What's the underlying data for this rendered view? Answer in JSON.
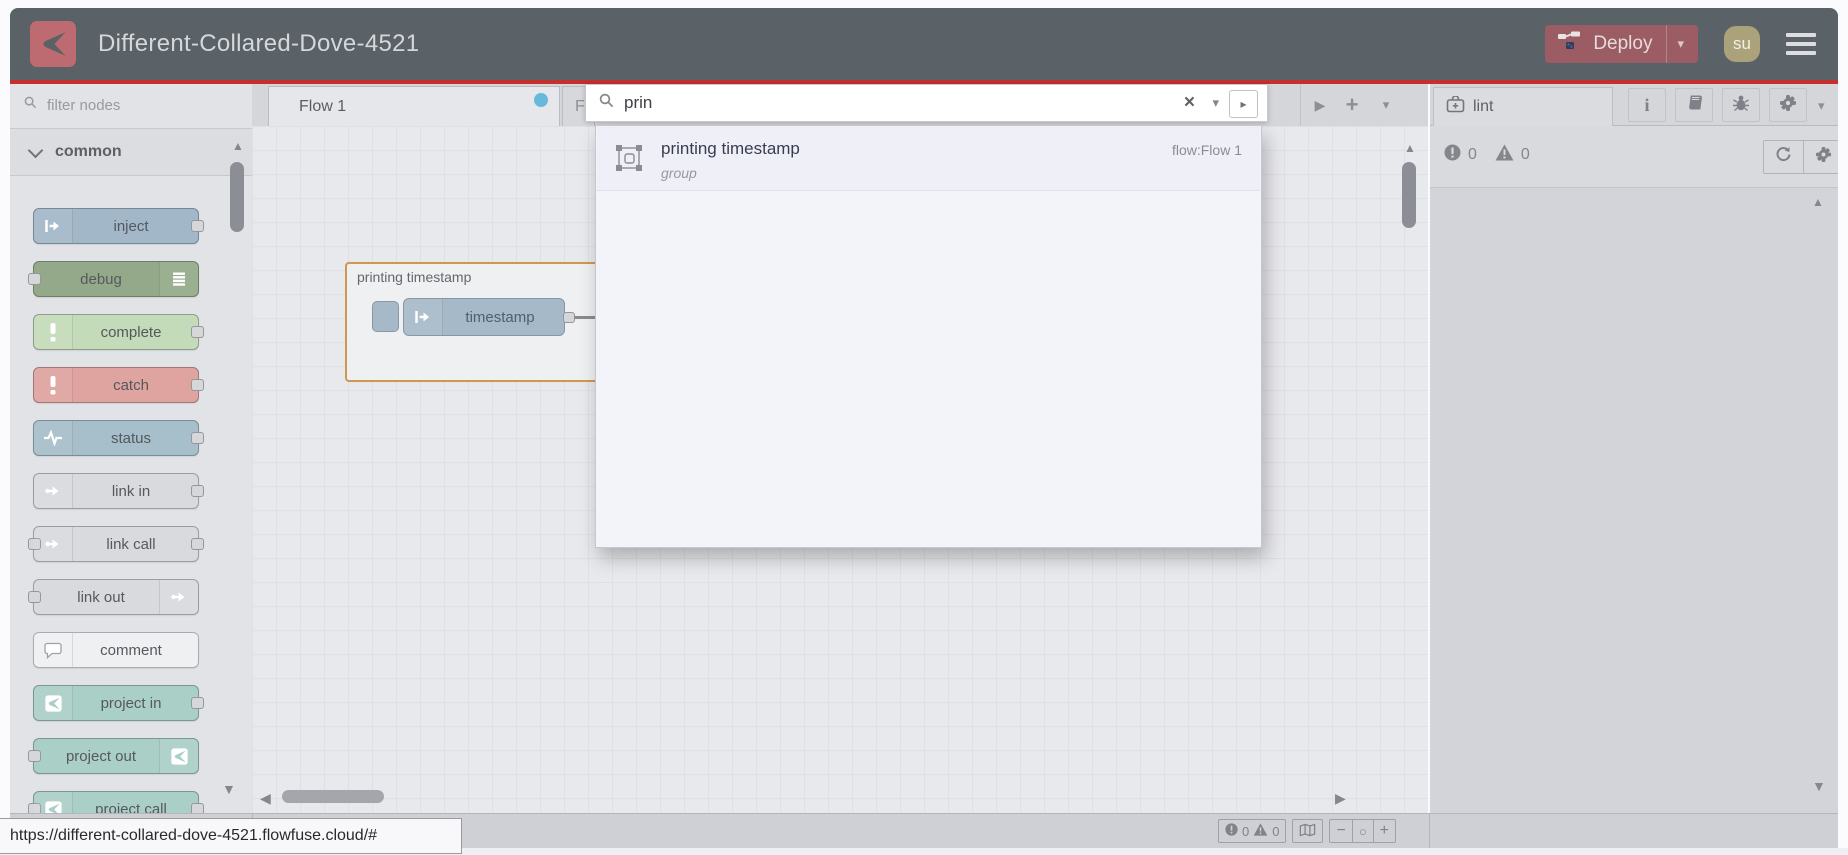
{
  "header": {
    "title": "Different-Collared-Dove-4521",
    "deploy_label": "Deploy",
    "avatar_initials": "su"
  },
  "palette": {
    "filter_placeholder": "filter nodes",
    "category": "common",
    "nodes": [
      {
        "label": "inject",
        "color": "#a2b7c8",
        "icon": "inject-arrow",
        "icon_side": "left",
        "port_left": false,
        "port_right": true
      },
      {
        "label": "debug",
        "color": "#94a989",
        "icon": "debug-lines",
        "icon_side": "right",
        "port_left": true,
        "port_right": false
      },
      {
        "label": "complete",
        "color": "#c3dbb8",
        "icon": "exclaim",
        "icon_side": "left",
        "port_left": false,
        "port_right": true
      },
      {
        "label": "catch",
        "color": "#dfa3a0",
        "icon": "exclaim",
        "icon_side": "left",
        "port_left": false,
        "port_right": true
      },
      {
        "label": "status",
        "color": "#a6bfca",
        "icon": "pulse",
        "icon_side": "left",
        "port_left": false,
        "port_right": true
      },
      {
        "label": "link in",
        "color": "#d9dadd",
        "icon": "link-arrow",
        "icon_side": "left",
        "port_left": false,
        "port_right": true
      },
      {
        "label": "link call",
        "color": "#d9dadd",
        "icon": "link-arrow",
        "icon_side": "left",
        "port_left": true,
        "port_right": true
      },
      {
        "label": "link out",
        "color": "#d9dadd",
        "icon": "link-arrow",
        "icon_side": "right",
        "port_left": true,
        "port_right": false
      },
      {
        "label": "comment",
        "color": "#eef0f1",
        "icon": "comment-bubble",
        "icon_side": "left",
        "port_left": false,
        "port_right": false
      },
      {
        "label": "project in",
        "color": "#aacfc7",
        "icon": "project-logo",
        "icon_side": "left",
        "port_left": false,
        "port_right": true
      },
      {
        "label": "project out",
        "color": "#aacfc7",
        "icon": "project-logo",
        "icon_side": "right",
        "port_left": true,
        "port_right": false
      },
      {
        "label": "project call",
        "color": "#aacfc7",
        "icon": "project-logo",
        "icon_side": "left",
        "port_left": true,
        "port_right": true
      }
    ]
  },
  "tabs": {
    "active": "Flow 1",
    "active_modified": true,
    "partial": "Fl"
  },
  "canvas": {
    "group_label": "printing timestamp",
    "node_label": "timestamp"
  },
  "search": {
    "query": "prin",
    "result": {
      "title": "printing timestamp",
      "type": "group",
      "location": "flow:Flow 1"
    }
  },
  "sidebar": {
    "tab_label": "lint",
    "error_count": "0",
    "warning_count": "0"
  },
  "footer": {
    "error_count": "0",
    "warning_count": "0"
  },
  "statusbar": {
    "url": "https://different-collared-dove-4521.flowfuse.cloud/#"
  },
  "glyphs": {
    "caret_down": "▾",
    "caret_right": "▸",
    "scroll_up": "▲",
    "scroll_down": "▼",
    "scroll_left": "◀",
    "scroll_right": "▶",
    "clear": "×",
    "add": "+",
    "zoom_out": "−",
    "zoom_reset": "○",
    "zoom_in": "+"
  },
  "colors": {
    "header_bg": "#5a6167",
    "accent_red": "#c5302e",
    "deploy_bg": "#9b5c63",
    "logo_red": "#bd6b70",
    "avatar_bg": "#aba27b",
    "group_border": "#d0984f",
    "tab_modified_dot": "#66b9da",
    "canvas_bg": "#e8e9ec",
    "search_panel_bg": "#f3f4fa"
  }
}
